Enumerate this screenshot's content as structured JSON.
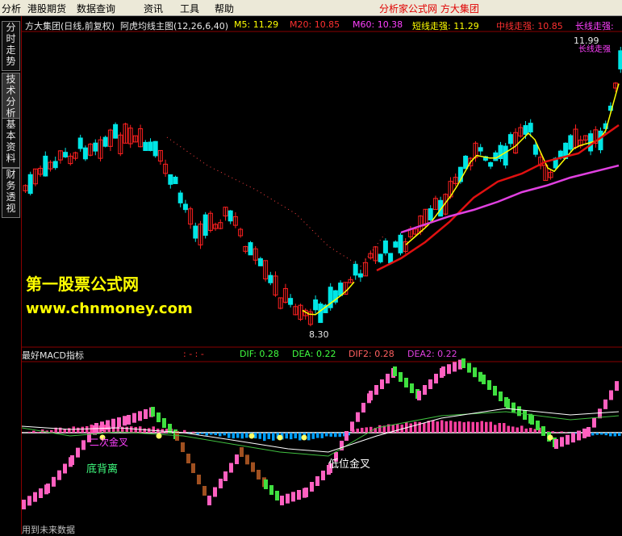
{
  "menu": {
    "items": [
      "分析",
      "港股期货",
      "数据查询",
      "资讯",
      "工具",
      "帮助"
    ],
    "app_title": "分析家公式网  方大集团"
  },
  "sidebar": {
    "tabs": [
      "分时走势",
      "技术分析",
      "基本资料",
      "财务透视"
    ]
  },
  "main_chart": {
    "header": {
      "stock": "方大集团(日线,前复权)",
      "indicator": "阿虎均线主图(12,26,6,40)",
      "m5": "M5: 11.29",
      "m20": "M20: 10.85",
      "m60": "M60: 10.38",
      "short_strong": "短线走强: 11.29",
      "mid_strong": "中线走强: 10.85",
      "long_strong": "长线走强:"
    },
    "high_label": "11.99",
    "low_label": "8.30",
    "right_tag": "长线走强",
    "colors": {
      "up": "#ff2020",
      "down": "#00e5e5",
      "m5": "#ffff00",
      "m20": "#e01010",
      "m60": "#e040e0"
    }
  },
  "macd_chart": {
    "header": {
      "title": "最好MACD指标",
      "dashes": ": -  : -",
      "dif": "DIF: 0.28",
      "dea": "DEA: 0.22",
      "dif2": "DIF2: 0.28",
      "dea2": "DEA2: 0.22"
    },
    "annotations": {
      "second_golden_cross": "二次金叉",
      "bottom_divergence": "底背离",
      "low_golden_cross": "低位金叉"
    },
    "footer": "用到未来数据"
  },
  "watermark": {
    "line1": "第一股票公式网",
    "line2": "www.chnmoney.com"
  }
}
